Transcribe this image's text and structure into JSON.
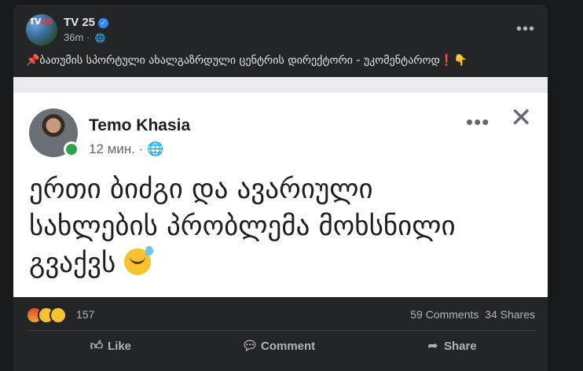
{
  "post": {
    "page_name": "TV 25",
    "avatar_logo": "TV25",
    "time": "36m",
    "caption": "📌ბათუმის სპორტული ახალგაზრდული ცენტრის დირექტორი - უკომენტაროდ❗👇"
  },
  "shared": {
    "author": "Temo Khasia",
    "time": "12 мин. ·",
    "line1": "ერთი ბიძგი და ავარიული",
    "line2": "სახლების პრობლემა მოხსნილი",
    "line3": "გვაქვს"
  },
  "stats": {
    "reaction_count": "157",
    "comments": "59 Comments",
    "shares": "34 Shares"
  },
  "actions": {
    "like": "Like",
    "comment": "Comment",
    "share": "Share"
  },
  "icons": [
    "verified-icon",
    "globe-icon",
    "more-icon",
    "close-icon",
    "like-icon",
    "comment-icon",
    "share-icon"
  ]
}
